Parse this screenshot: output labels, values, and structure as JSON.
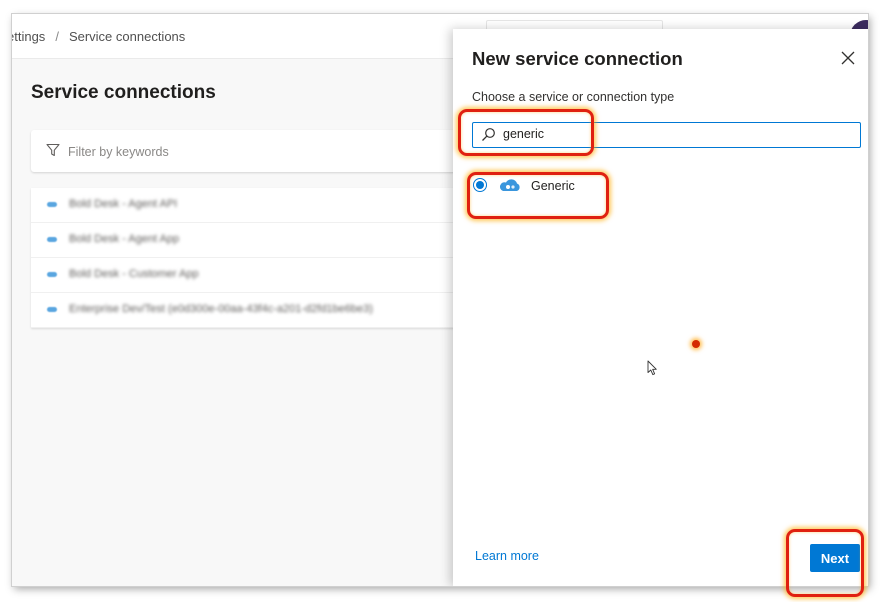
{
  "breadcrumb": {
    "parent": "ettings",
    "separator": "/",
    "current": "Service connections"
  },
  "page": {
    "title": "Service connections"
  },
  "filter": {
    "placeholder": "Filter by keywords"
  },
  "connections": [
    {
      "label": "Bold Desk - Agent API",
      "icon": "azure-icon"
    },
    {
      "label": "Bold Desk - Agent App",
      "icon": "azure-icon"
    },
    {
      "label": "Bold Desk - Customer App",
      "icon": "azure-icon"
    },
    {
      "label": "Enterprise Dev/Test (e0d300e-00aa-43f4c-a201-d2fd1be6be3)",
      "icon": "azure-icon"
    }
  ],
  "panel": {
    "title": "New service connection",
    "subtitle": "Choose a service or connection type",
    "search": {
      "value": "generic",
      "placeholder": ""
    },
    "options": [
      {
        "label": "Generic",
        "selected": true,
        "icon": "cloud-icon"
      }
    ],
    "learn_more": "Learn more",
    "next_label": "Next"
  },
  "colors": {
    "accent": "#0078d4",
    "highlight": "#e02010"
  }
}
